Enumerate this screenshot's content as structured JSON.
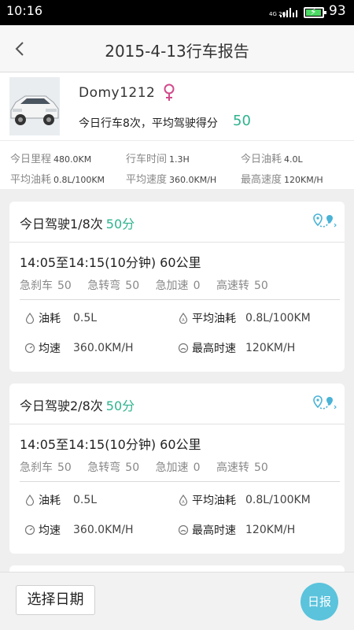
{
  "status_bar": {
    "time": "10:16",
    "network": "4G 2G",
    "battery_percent": "93",
    "battery_level": 0.93
  },
  "header": {
    "title": "2015-4-13行车报告",
    "back_icon": "chevron-left-icon"
  },
  "profile": {
    "username": "Domy1212",
    "gender_icon": "female-icon",
    "summary": "今日行车8次，平均驾驶得分",
    "score": "50"
  },
  "stats": [
    {
      "label": "今日里程",
      "value": "480.0KM"
    },
    {
      "label": "行车时间",
      "value": "1.3H"
    },
    {
      "label": "今日油耗",
      "value": "4.0L"
    },
    {
      "label": "平均油耗",
      "value": "0.8L/100KM"
    },
    {
      "label": "平均速度",
      "value": "360.0KM/H"
    },
    {
      "label": "最高速度",
      "value": "120KM/H"
    }
  ],
  "trips": [
    {
      "title": "今日驾驶1/8次",
      "score": "50分",
      "time_range": "14:05至14:15(10分钟) 60公里",
      "events": [
        {
          "label": "急刹车",
          "value": "50"
        },
        {
          "label": "急转弯",
          "value": "50"
        },
        {
          "label": "急加速",
          "value": "0"
        },
        {
          "label": "高速转",
          "value": "50"
        }
      ],
      "fuel_label": "油耗",
      "fuel_value": "0.5L",
      "avg_fuel_label": "平均油耗",
      "avg_fuel_value": "0.8L/100KM",
      "avg_speed_label": "均速",
      "avg_speed_value": "360.0KM/H",
      "max_speed_label": "最高时速",
      "max_speed_value": "120KM/H"
    },
    {
      "title": "今日驾驶2/8次",
      "score": "50分",
      "time_range": "14:05至14:15(10分钟) 60公里",
      "events": [
        {
          "label": "急刹车",
          "value": "50"
        },
        {
          "label": "急转弯",
          "value": "50"
        },
        {
          "label": "急加速",
          "value": "0"
        },
        {
          "label": "高速转",
          "value": "50"
        }
      ],
      "fuel_label": "油耗",
      "fuel_value": "0.5L",
      "avg_fuel_label": "平均油耗",
      "avg_fuel_value": "0.8L/100KM",
      "avg_speed_label": "均速",
      "avg_speed_value": "360.0KM/H",
      "max_speed_label": "最高时速",
      "max_speed_value": "120KM/H"
    }
  ],
  "bottom_bar": {
    "select_date": "选择日期",
    "daily_report": "日报"
  },
  "colors": {
    "accent_green": "#2db38e",
    "accent_blue": "#5bc3dc"
  }
}
